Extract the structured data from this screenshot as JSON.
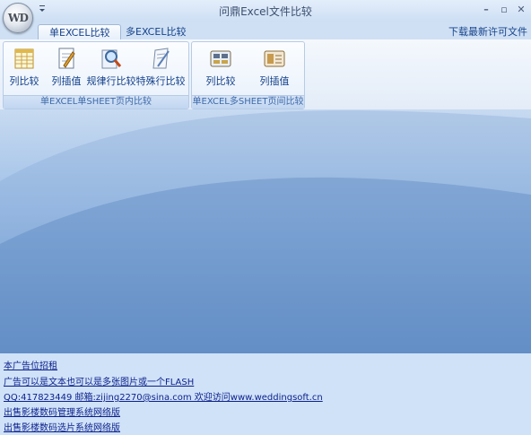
{
  "window": {
    "title": "问鼎Excel文件比较",
    "logo_text": "WD"
  },
  "tabs": [
    {
      "label": "单EXCEL比较",
      "active": true
    },
    {
      "label": "多EXCEL比较",
      "active": false
    }
  ],
  "download_link": "下载最新许可文件",
  "groups": [
    {
      "label": "单EXCEL单SHEET页内比较",
      "buttons": [
        {
          "label": "列比较",
          "icon": "column-compare-icon"
        },
        {
          "label": "列插值",
          "icon": "column-diff-icon"
        },
        {
          "label": "规律行比较",
          "icon": "pattern-row-search-icon"
        },
        {
          "label": "特殊行比较",
          "icon": "special-row-icon"
        }
      ]
    },
    {
      "label": "单EXCEL多SHEET页间比较",
      "buttons": [
        {
          "label": "列比较",
          "icon": "sheet-column-compare-icon"
        },
        {
          "label": "列插值",
          "icon": "sheet-column-diff-icon"
        }
      ]
    }
  ],
  "ads": [
    "本广告位招租",
    "广告可以是文本也可以是多张图片或一个FLASH",
    "QQ:417823449 邮箱:zijing2270@sina.com 欢迎访问www.weddingsoft.cn",
    "出售影楼数码管理系统网络版",
    "出售影楼数码选片系统网络版"
  ]
}
